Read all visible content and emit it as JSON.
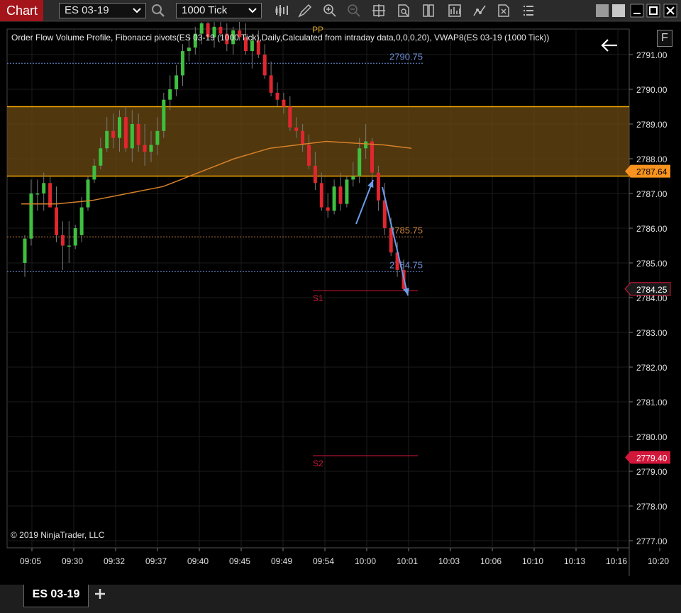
{
  "toolbar": {
    "chart_label": "Chart",
    "instrument": "ES 03-19",
    "interval": "1000 Tick"
  },
  "chart": {
    "indicator_label": "Order Flow Volume Profile, Fibonacci pivots(ES 03-19 (1000 Tick),Daily,Calculated from intraday data,0,0,0,20), VWAP8(ES 03-19 (1000 Tick))",
    "copyright": "© 2019 NinjaTrader, LLC",
    "f_button": "F",
    "y_labels": [
      "2791.00",
      "2790.00",
      "2789.00",
      "2788.00",
      "2787.00",
      "2786.00",
      "2785.00",
      "2784.00",
      "2783.00",
      "2782.00",
      "2781.00",
      "2780.00",
      "2779.00",
      "2778.00",
      "2777.00"
    ],
    "x_labels": [
      "09:05",
      "09:30",
      "09:32",
      "09:37",
      "09:40",
      "09:45",
      "09:49",
      "09:54",
      "10:00",
      "10:01",
      "10:03",
      "10:06",
      "10:10",
      "10:13",
      "10:16",
      "10:20"
    ],
    "markers": {
      "vwap": {
        "value": "2787.64",
        "color": "#f7931e"
      },
      "last_price": {
        "value": "2784.25",
        "color": "#1a1a1a"
      },
      "s2_price": {
        "value": "2779.40",
        "color": "#d3173a"
      }
    },
    "pivot_labels": {
      "pp": "PP",
      "s1": "S1",
      "s2": "S2",
      "fib_high": "2790.75",
      "fib_mid": "2785.75",
      "fib_low": "2784.75"
    },
    "colors": {
      "up_candle": "#3fbf3f",
      "down_candle": "#e0262f",
      "zone": "#6b4a12",
      "zone_border": "#f2a400",
      "vwap_line": "#d6802a",
      "fib_blue": "#6f8fd9",
      "fib_orange": "#c9823b",
      "pivot_red": "#d3173a",
      "arrow": "#6a9ce8"
    }
  },
  "tabs": {
    "active": "ES 03-19",
    "add": "+"
  }
}
